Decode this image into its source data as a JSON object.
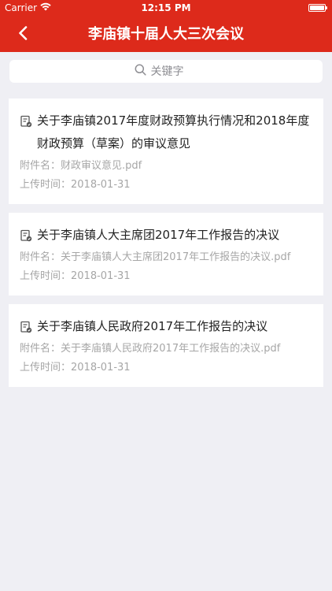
{
  "status_bar": {
    "carrier": "Carrier",
    "time": "12:15 PM",
    "battery_level": 1.0
  },
  "nav": {
    "title": "李庙镇十届人大三次会议"
  },
  "search": {
    "placeholder": "关键字",
    "value": ""
  },
  "documents": [
    {
      "title": "关于李庙镇2017年度财政预算执行情况和2018年度财政预算（草案）的审议意见",
      "attachment_label": "附件名：",
      "attachment": "财政审议意见.pdf",
      "upload_label": "上传时间：",
      "upload_time": "2018-01-31"
    },
    {
      "title": "关于李庙镇人大主席团2017年工作报告的决议",
      "attachment_label": "附件名：",
      "attachment": "关于李庙镇人大主席团2017年工作报告的决议.pdf",
      "upload_label": "上传时间：",
      "upload_time": "2018-01-31"
    },
    {
      "title": "关于李庙镇人民政府2017年工作报告的决议",
      "attachment_label": "附件名：",
      "attachment": "关于李庙镇人民政府2017年工作报告的决议.pdf",
      "upload_label": "上传时间：",
      "upload_time": "2018-01-31"
    }
  ],
  "colors": {
    "accent": "#dd2a1b",
    "background": "#efeff4",
    "meta_text": "#a6a6a6"
  },
  "icons": {
    "back": "chevron-left-icon",
    "search": "search-icon",
    "document": "document-icon",
    "wifi": "wifi-icon",
    "battery": "battery-icon"
  }
}
